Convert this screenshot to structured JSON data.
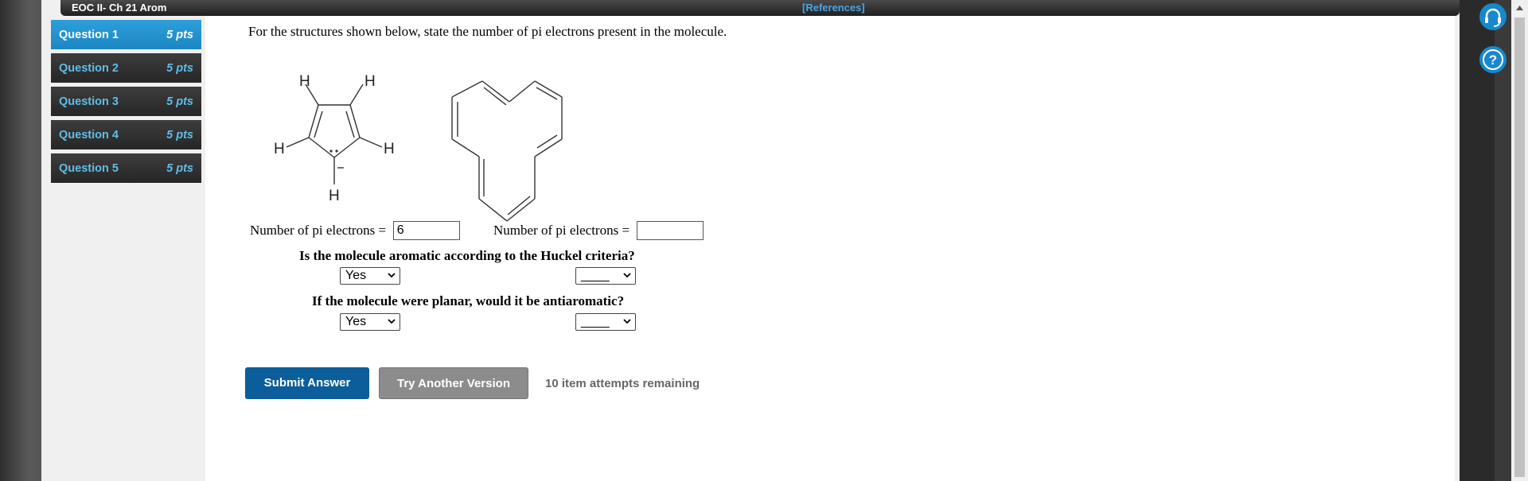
{
  "window": {
    "title": "EOC II- Ch 21 Arom",
    "references": "[References]"
  },
  "questions": [
    {
      "label": "Question 1",
      "points": "5 pts"
    },
    {
      "label": "Question 2",
      "points": "5 pts"
    },
    {
      "label": "Question 3",
      "points": "5 pts"
    },
    {
      "label": "Question 4",
      "points": "5 pts"
    },
    {
      "label": "Question 5",
      "points": "5 pts"
    }
  ],
  "active_question": 0,
  "prompt": "For the structures shown below, state the number of pi electrons present in the molecule.",
  "structure1": {
    "atom_labels": [
      "H",
      "H",
      "H",
      "H",
      "H"
    ],
    "charge": "−"
  },
  "answer1": {
    "label": "Number of pi electrons =",
    "value": "6"
  },
  "answer2": {
    "label": "Number of pi electrons =",
    "value": ""
  },
  "q_aromatic": {
    "text": "Is the molecule aromatic according to the Huckel criteria?",
    "select1": "Yes",
    "select2": "____"
  },
  "q_antiaromatic": {
    "text": "If the molecule were planar, would it be antiaromatic?",
    "select1": "Yes",
    "select2": "____"
  },
  "buttons": {
    "submit": "Submit Answer",
    "try_another": "Try Another Version"
  },
  "attempts": "10 item attempts remaining",
  "icons": {
    "support": "headset-icon",
    "help": "help-icon"
  },
  "colors": {
    "accent": "#1c86c2",
    "submit": "#0b5e9a",
    "try": "#8c8c8c"
  }
}
